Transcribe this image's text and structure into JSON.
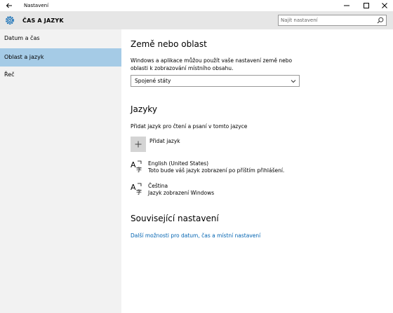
{
  "window": {
    "title": "Nastavení"
  },
  "header": {
    "section_title": "ČAS A JAZYK",
    "search_placeholder": "Najít nastavení"
  },
  "sidebar": {
    "items": [
      {
        "label": "Datum a čas",
        "active": false
      },
      {
        "label": "Oblast a jazyk",
        "active": true
      },
      {
        "label": "Řeč",
        "active": false
      }
    ]
  },
  "region": {
    "heading": "Země nebo oblast",
    "description_line1": "Windows a aplikace můžou použít vaše nastavení země nebo",
    "description_line2": "oblasti k zobrazování místního obsahu.",
    "selected_country": "Spojené státy"
  },
  "languages": {
    "heading": "Jazyky",
    "description": "Přidat jazyk pro čtení a psaní v tomto jazyce",
    "add_label": "Přidat jazyk",
    "items": [
      {
        "name": "English (United States)",
        "sub": "Toto bude váš jazyk zobrazení po příštím přihlášení."
      },
      {
        "name": "Čeština",
        "sub": "Jazyk zobrazení Windows"
      }
    ]
  },
  "related": {
    "heading": "Související nastavení",
    "link": "Další možnosti pro datum, čas a místní nastavení"
  },
  "colors": {
    "accent": "#0063b1",
    "sidebar_active": "#a5cbe6",
    "header_bg": "#e6e6e6",
    "sidebar_bg": "#f2f2f2"
  }
}
